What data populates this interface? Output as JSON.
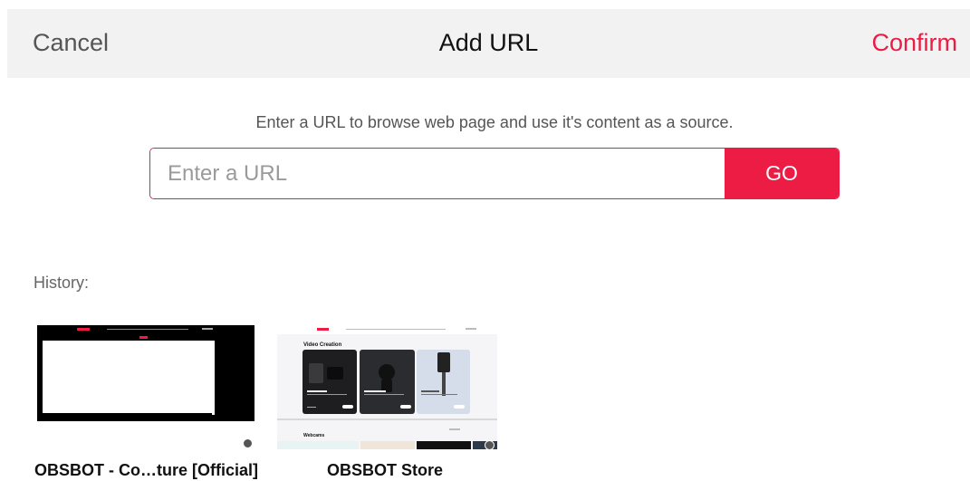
{
  "header": {
    "cancel_label": "Cancel",
    "title": "Add URL",
    "confirm_label": "Confirm"
  },
  "url_entry": {
    "instructions": "Enter a URL to browse web page and use it's content as a source.",
    "placeholder": "Enter a URL",
    "value": "",
    "go_label": "GO"
  },
  "history": {
    "label": "History:",
    "items": [
      {
        "title": "OBSBOT - Co…ture [Official]"
      },
      {
        "title": "OBSBOT Store",
        "section_heading": "Video Creation",
        "lower_heading": "Webcams"
      }
    ]
  },
  "colors": {
    "accent": "#ec1c45",
    "header_bg": "#f2f2f2",
    "muted_text": "#555555"
  }
}
